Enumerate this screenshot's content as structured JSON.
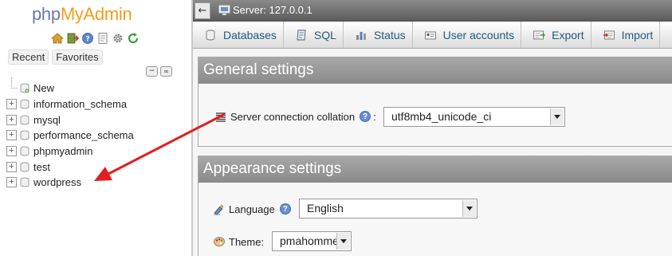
{
  "logo": {
    "php": "php",
    "myadmin": "MyAdmin"
  },
  "nav": {
    "icons": [
      "home-icon",
      "exit-icon",
      "help-icon",
      "docs-icon",
      "settings-icon",
      "reload-icon"
    ],
    "recent_label": "Recent",
    "favorites_label": "Favorites",
    "tree": [
      {
        "label": "New",
        "type": "new"
      },
      {
        "label": "information_schema",
        "type": "db"
      },
      {
        "label": "mysql",
        "type": "db"
      },
      {
        "label": "performance_schema",
        "type": "db"
      },
      {
        "label": "phpmyadmin",
        "type": "db"
      },
      {
        "label": "test",
        "type": "db"
      },
      {
        "label": "wordpress",
        "type": "db"
      }
    ]
  },
  "serverbar": {
    "back_symbol": "←",
    "label": "Server: 127.0.0.1"
  },
  "tabs": [
    {
      "label": "Databases",
      "icon": "database-icon"
    },
    {
      "label": "SQL",
      "icon": "sql-icon"
    },
    {
      "label": "Status",
      "icon": "status-icon"
    },
    {
      "label": "User accounts",
      "icon": "users-icon"
    },
    {
      "label": "Export",
      "icon": "export-icon"
    },
    {
      "label": "Import",
      "icon": "import-icon"
    }
  ],
  "general": {
    "title": "General settings",
    "collation_label": "Server connection collation",
    "collation_suffix": ":",
    "collation_value": "utf8mb4_unicode_ci"
  },
  "appearance": {
    "title": "Appearance settings",
    "language_label": "Language",
    "language_value": "English",
    "theme_label": "Theme:",
    "theme_value": "pmahomme"
  },
  "colors": {
    "logo_php": "#6c78af",
    "logo_myadmin": "#f29c1b",
    "tab_text": "#235a81",
    "annotation_arrow": "#e41e1e"
  }
}
